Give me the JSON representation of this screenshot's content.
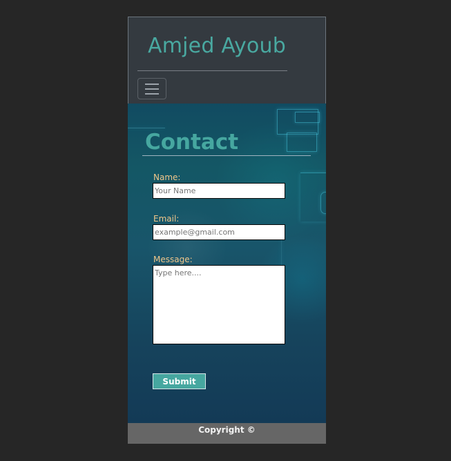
{
  "navbar": {
    "brand": "Amjed Ayoub",
    "menu_icon": "menu-icon"
  },
  "main": {
    "title": "Contact",
    "form": {
      "name_label": "Name:",
      "name_value": "",
      "name_placeholder": "Your Name",
      "email_label": "Email:",
      "email_value": "",
      "email_placeholder": "example@gmail.com",
      "message_label": "Message:",
      "message_value": "",
      "message_placeholder": "Type here....",
      "submit_label": "Submit"
    }
  },
  "footer": {
    "copyright": "Copyright ©"
  },
  "colors": {
    "accent": "#46a7a0",
    "label": "#f0c68a",
    "navbar_bg": "#343a40",
    "footer_bg": "#666666"
  }
}
